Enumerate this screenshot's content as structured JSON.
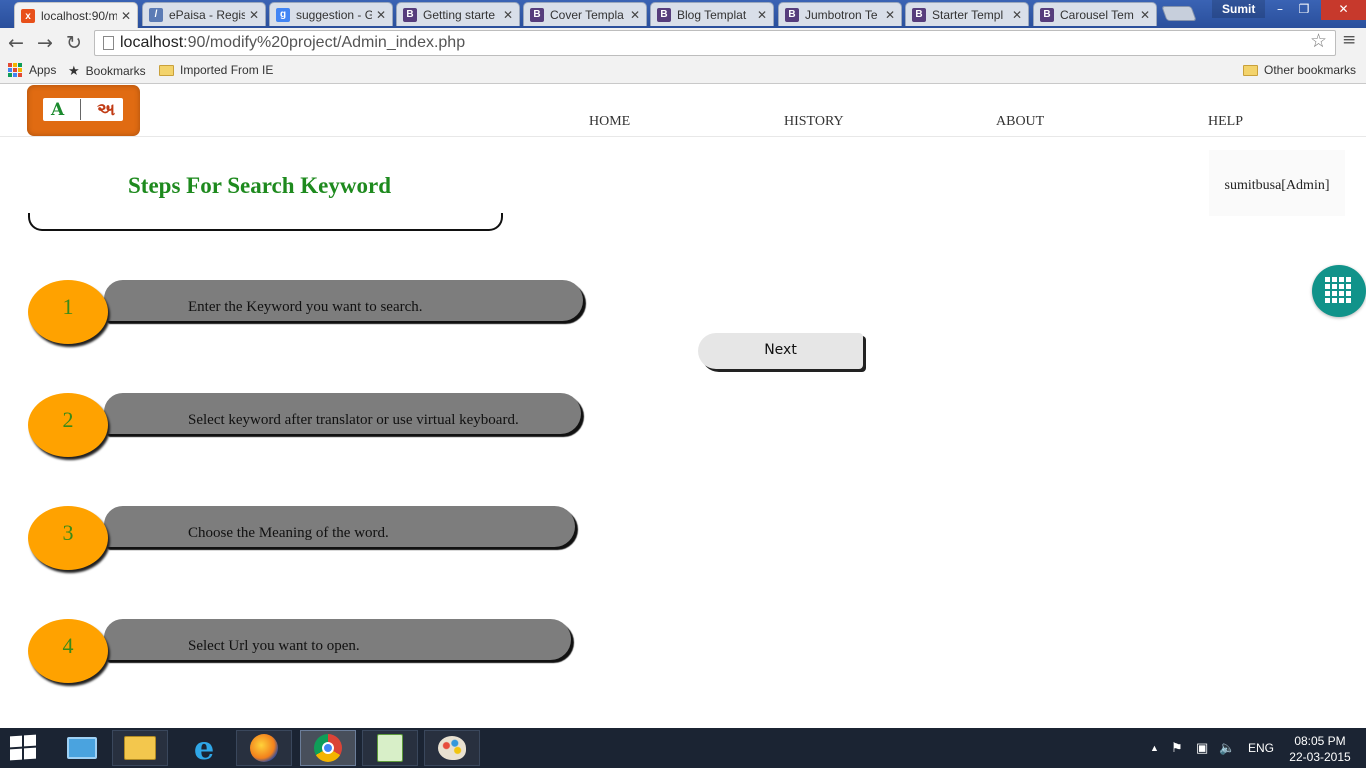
{
  "browser": {
    "tabs": [
      {
        "label": "localhost:90/m",
        "favicon": "xampp-icon",
        "color": "#e8501a",
        "active": true
      },
      {
        "label": "ePaisa - Regis",
        "favicon": "feather-icon",
        "color": "#5b7bb5",
        "active": false
      },
      {
        "label": "suggestion - G",
        "favicon": "google-icon",
        "color": "#4285f4",
        "active": false
      },
      {
        "label": "Getting starte",
        "favicon": "bootstrap-icon",
        "color": "#563d7c",
        "active": false
      },
      {
        "label": "Cover Templa",
        "favicon": "bootstrap-icon",
        "color": "#563d7c",
        "active": false
      },
      {
        "label": "Blog Templat",
        "favicon": "bootstrap-icon",
        "color": "#563d7c",
        "active": false
      },
      {
        "label": "Jumbotron Te",
        "favicon": "bootstrap-icon",
        "color": "#563d7c",
        "active": false
      },
      {
        "label": "Starter Templ",
        "favicon": "bootstrap-icon",
        "color": "#563d7c",
        "active": false
      },
      {
        "label": "Carousel Tem",
        "favicon": "bootstrap-icon",
        "color": "#563d7c",
        "active": false
      }
    ],
    "close_glyph": "✕",
    "profile_name": "Sumit",
    "url_host": "localhost",
    "url_rest": ":90/modify%20project/Admin_index.php",
    "bookmarks": {
      "apps": "Apps",
      "bookmarks": "Bookmarks",
      "imported": "Imported From IE",
      "other": "Other bookmarks"
    }
  },
  "site": {
    "logo_left": "A",
    "logo_right": "અ",
    "nav": [
      "HOME",
      "HISTORY",
      "ABOUT",
      "HELP"
    ],
    "title": "Steps For Search Keyword",
    "user": "sumitbusa[Admin]",
    "next_label": "Next",
    "steps": [
      {
        "num": "1",
        "text": "Enter the Keyword you want to search."
      },
      {
        "num": "2",
        "text": "Select keyword after translator or use virtual keyboard."
      },
      {
        "num": "3",
        "text": "Choose the Meaning of the word."
      },
      {
        "num": "4",
        "text": "Select Url you want to open."
      }
    ],
    "colors": {
      "accent_green": "#1e8a1e",
      "step_orange": "#ffa200",
      "pill_gray": "#7d7d7d",
      "fab_teal": "#11938a"
    }
  },
  "taskbar": {
    "language": "ENG",
    "time": "08:05 PM",
    "date": "22-03-2015"
  }
}
